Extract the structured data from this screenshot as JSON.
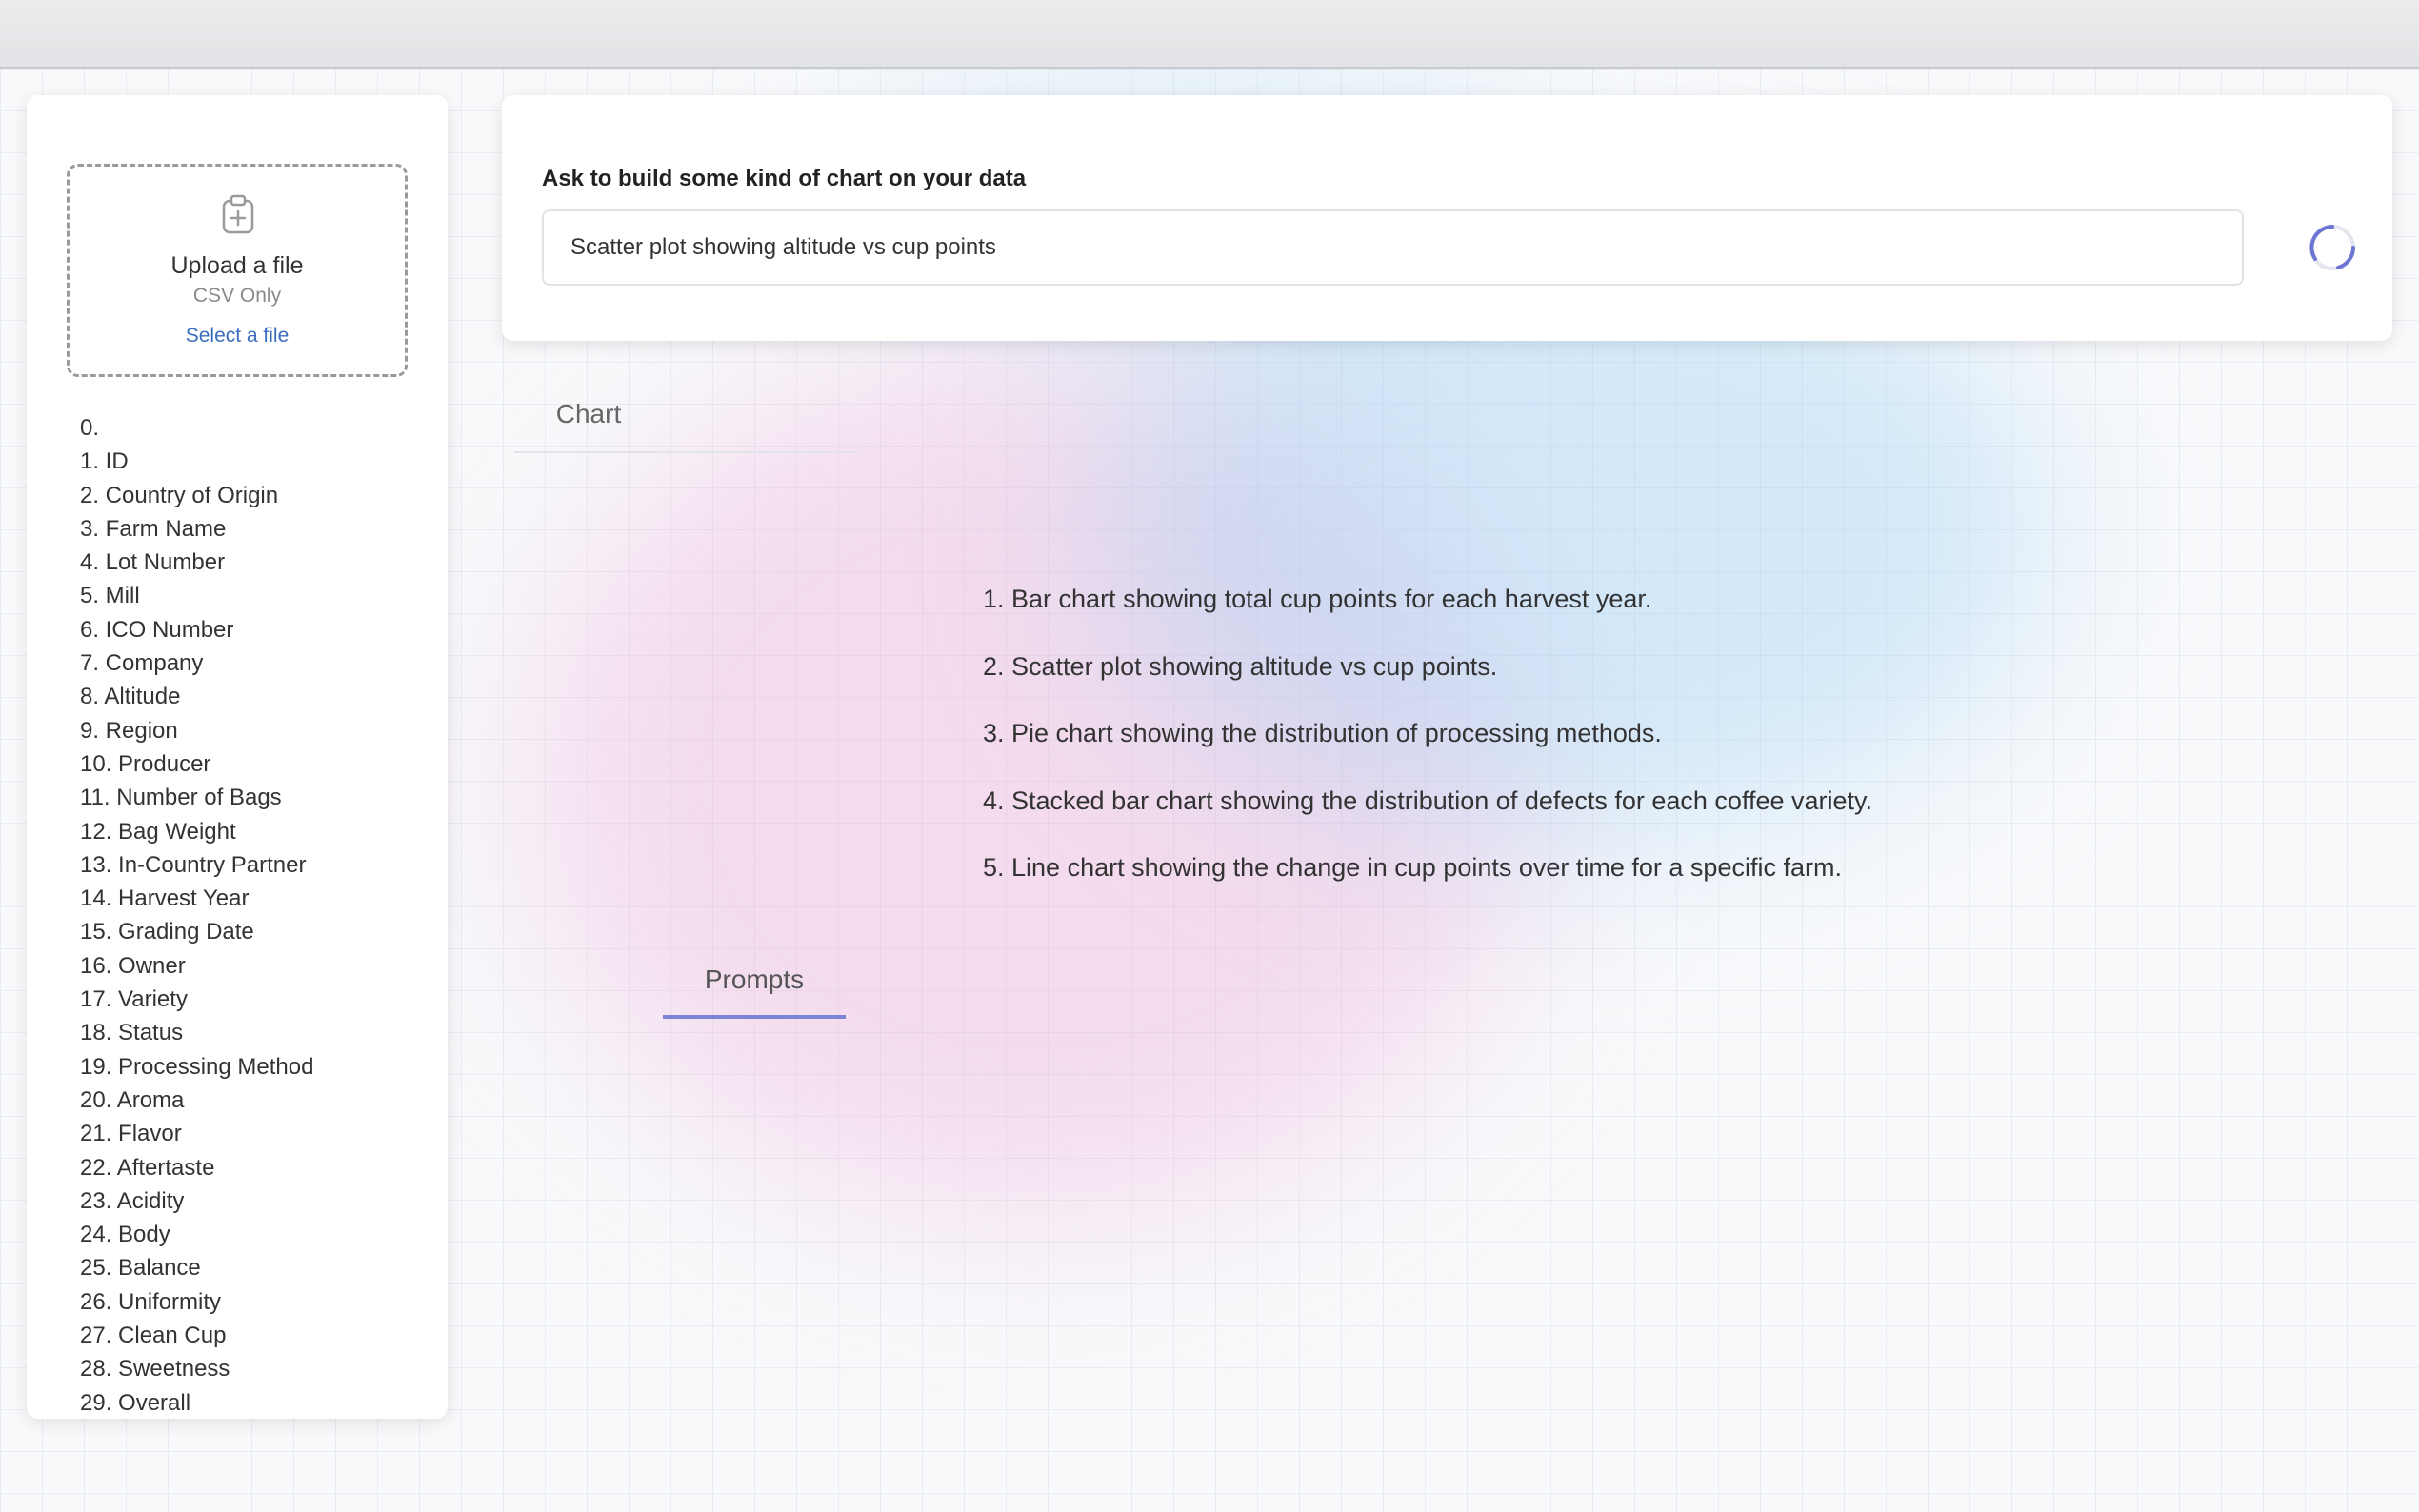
{
  "sidebar": {
    "upload": {
      "title": "Upload a file",
      "subtitle": "CSV Only",
      "link": "Select a file"
    },
    "columns": [
      "0.",
      "1. ID",
      "2. Country of Origin",
      "3. Farm Name",
      "4. Lot Number",
      "5. Mill",
      "6. ICO Number",
      "7. Company",
      "8. Altitude",
      "9. Region",
      "10. Producer",
      "11. Number of Bags",
      "12. Bag Weight",
      "13. In-Country Partner",
      "14. Harvest Year",
      "15. Grading Date",
      "16. Owner",
      "17. Variety",
      "18. Status",
      "19. Processing Method",
      "20. Aroma",
      "21. Flavor",
      "22. Aftertaste",
      "23. Acidity",
      "24. Body",
      "25. Balance",
      "26. Uniformity",
      "27. Clean Cup",
      "28. Sweetness",
      "29. Overall"
    ]
  },
  "query": {
    "label": "Ask to build some kind of chart on your data",
    "value": "Scatter plot showing altitude vs cup points"
  },
  "tabs": [
    {
      "label": "Chart",
      "active": false
    },
    {
      "label": "Prompts",
      "active": true
    }
  ],
  "prompts": [
    "1. Bar chart showing total cup points for each harvest year.",
    "2. Scatter plot showing altitude vs cup points.",
    "3. Pie chart showing the distribution of processing methods.",
    "4. Stacked bar chart showing the distribution of defects for each coffee variety.",
    "5. Line chart showing the change in cup points over time for a specific farm."
  ],
  "colors": {
    "accent": "#7c84d6",
    "link": "#3b6dbf",
    "spinner": "#6c74d4"
  },
  "icons": {
    "upload": "clipboard-plus-icon",
    "loading": "loading-spinner-icon"
  }
}
